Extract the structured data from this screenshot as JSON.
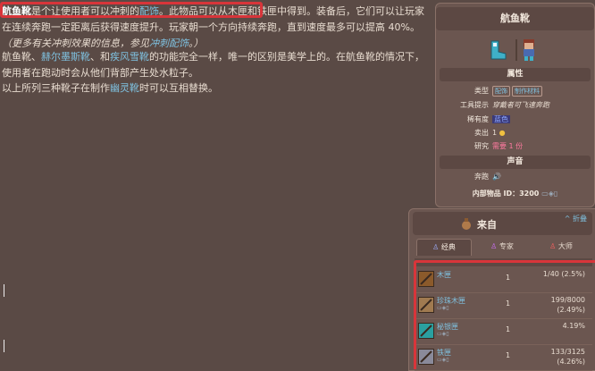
{
  "article": {
    "p1": {
      "s1": "航鱼靴",
      "s2": "是个让使用者可以冲刺的",
      "s3": "配饰",
      "s4": "。此物品可以从木匣和铁匣中得到",
      "s5": "。装备后，它们可以让玩家在连续奔跑",
      "s6": "一定距离后获得速度提升。玩家朝一个方向持续奔跑，直到速度最多可以提高 40%。",
      "s7": "（更多有关冲刺效果的信息，参见",
      "s8": "冲刺配饰",
      "s9": "。）"
    },
    "p2": {
      "s1": "航鱼靴",
      "s2": "、",
      "s3": "赫尔墨斯靴",
      "s4": "、和",
      "s5": "疾风雪靴",
      "s6": "的功能完全一样，唯一的区别是美学上的。在航鱼靴的情况下，使用者在跑动时会从他们背部产生处水粒子。"
    },
    "p3": {
      "s1": "以上所列三种靴子在制作",
      "s2": "幽灵靴",
      "s3": "时可以互相替换。"
    }
  },
  "infobox": {
    "title": "航鱼靴",
    "icons": [
      "boots-icon",
      "player-icon"
    ],
    "section_props": "属性",
    "type_label": "类型",
    "type_tags": [
      "配饰",
      "制作材料"
    ],
    "tooltip_label": "工具提示",
    "tooltip_value": "穿戴者可飞速奔跑",
    "rarity_label": "稀有度",
    "rarity_value": "蓝色",
    "sell_label": "卖出",
    "sell_value": "1",
    "research_label": "研究",
    "research_value": "需要 1 份",
    "section_sound": "声音",
    "run_label": "奔跑",
    "item_id_label": "内部物品 ID：",
    "item_id_value": "3200"
  },
  "source": {
    "title": "来自",
    "collapse_label": "折叠",
    "tabs": [
      {
        "label": "经典",
        "icon": "classic-icon"
      },
      {
        "label": "专家",
        "icon": "expert-icon"
      },
      {
        "label": "大师",
        "icon": "master-icon"
      }
    ],
    "header": {
      "c1": "来源",
      "c2": "数量",
      "c3": "几率"
    },
    "rows": [
      {
        "name": "木匣",
        "sub": "",
        "qty": "1",
        "rate1": "1/40 (2.5%)",
        "rate2": "",
        "color": "#8b5a2b"
      },
      {
        "name": "珍珠木匣",
        "sub": "",
        "qty": "1",
        "rate1": "199/8000",
        "rate2": "(2.49%)",
        "color": "#a07a50"
      },
      {
        "name": "秘银匣",
        "sub": "",
        "qty": "1",
        "rate1": "4.19%",
        "rate2": "",
        "color": "#2aa0a0"
      },
      {
        "name": "铁匣",
        "sub": "",
        "qty": "1",
        "rate1": "133/3125",
        "rate2": "(4.26%)",
        "color": "#8a8a9a"
      }
    ]
  }
}
